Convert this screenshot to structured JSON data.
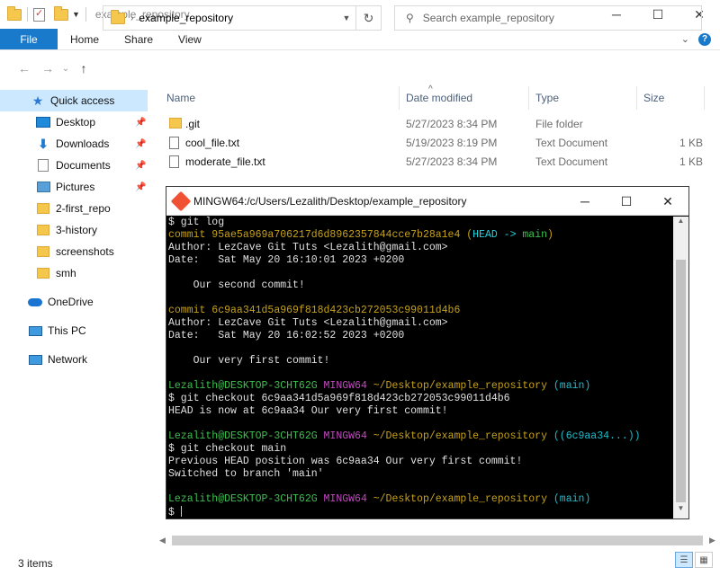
{
  "window": {
    "title": "example_repository",
    "min": "─",
    "max": "☐",
    "close": "✕"
  },
  "ribbon": {
    "file": "File",
    "tabs": [
      "Home",
      "Share",
      "View"
    ],
    "chevron": "⌄",
    "help": "?"
  },
  "nav": {
    "back": "←",
    "forward": "→",
    "recent": "⌄",
    "up": "↑",
    "breadcrumb_sep": "›",
    "path": "example_repository",
    "refresh": "↻",
    "search_placeholder": "Search example_repository"
  },
  "sidebar": {
    "items": [
      {
        "label": "Quick access",
        "icon": "star-icon"
      },
      {
        "label": "Desktop",
        "icon": "desktop-icon"
      },
      {
        "label": "Downloads",
        "icon": "download-icon"
      },
      {
        "label": "Documents",
        "icon": "documents-icon"
      },
      {
        "label": "Pictures",
        "icon": "pictures-icon"
      },
      {
        "label": "2-first_repo",
        "icon": "folder-icon"
      },
      {
        "label": "3-history",
        "icon": "folder-icon"
      },
      {
        "label": "screenshots",
        "icon": "folder-icon"
      },
      {
        "label": "smh",
        "icon": "folder-icon"
      },
      {
        "label": "OneDrive",
        "icon": "cloud-icon"
      },
      {
        "label": "This PC",
        "icon": "computer-icon"
      },
      {
        "label": "Network",
        "icon": "network-icon"
      }
    ]
  },
  "columns": {
    "name": "Name",
    "date": "Date modified",
    "type": "Type",
    "size": "Size"
  },
  "files": [
    {
      "name": ".git",
      "date": "5/27/2023 8:34 PM",
      "type": "File folder",
      "size": "",
      "icon": "folder-icon"
    },
    {
      "name": "cool_file.txt",
      "date": "5/19/2023 8:19 PM",
      "type": "Text Document",
      "size": "1 KB",
      "icon": "text-file-icon"
    },
    {
      "name": "moderate_file.txt",
      "date": "5/27/2023 8:34 PM",
      "type": "Text Document",
      "size": "1 KB",
      "icon": "text-file-icon"
    }
  ],
  "terminal": {
    "title": "MINGW64:/c/Users/Lezalith/Desktop/example_repository",
    "lines": [
      [
        {
          "t": "$ git log",
          "c": "c-w"
        }
      ],
      [
        {
          "t": "commit 95ae5a969a706217d6d8962357844cce7b28a1e4 ",
          "c": "c-y"
        },
        {
          "t": "(",
          "c": "c-y"
        },
        {
          "t": "HEAD -> ",
          "c": "c-hd"
        },
        {
          "t": "main",
          "c": "c-main"
        },
        {
          "t": ")",
          "c": "c-y"
        }
      ],
      [
        {
          "t": "Author: LezCave Git Tuts <Lezalith@gmail.com>",
          "c": "c-w"
        }
      ],
      [
        {
          "t": "Date:   Sat May 20 16:10:01 2023 +0200",
          "c": "c-w"
        }
      ],
      [
        {
          "t": "",
          "c": "c-w"
        }
      ],
      [
        {
          "t": "    Our second commit!",
          "c": "c-w"
        }
      ],
      [
        {
          "t": "",
          "c": "c-w"
        }
      ],
      [
        {
          "t": "commit 6c9aa341d5a969f818d423cb272053c99011d4b6",
          "c": "c-y"
        }
      ],
      [
        {
          "t": "Author: LezCave Git Tuts <Lezalith@gmail.com>",
          "c": "c-w"
        }
      ],
      [
        {
          "t": "Date:   Sat May 20 16:02:52 2023 +0200",
          "c": "c-w"
        }
      ],
      [
        {
          "t": "",
          "c": "c-w"
        }
      ],
      [
        {
          "t": "    Our very first commit!",
          "c": "c-w"
        }
      ],
      [
        {
          "t": "",
          "c": "c-w"
        }
      ],
      [
        {
          "t": "Lezalith@DESKTOP-3CHT62G ",
          "c": "c-g"
        },
        {
          "t": "MINGW64 ",
          "c": "c-m"
        },
        {
          "t": "~/Desktop/example_repository ",
          "c": "c-y"
        },
        {
          "t": "(main)",
          "c": "c-cy"
        }
      ],
      [
        {
          "t": "$ git checkout 6c9aa341d5a969f818d423cb272053c99011d4b6",
          "c": "c-w"
        }
      ],
      [
        {
          "t": "HEAD is now at 6c9aa34 Our very first commit!",
          "c": "c-w"
        }
      ],
      [
        {
          "t": "",
          "c": "c-w"
        }
      ],
      [
        {
          "t": "Lezalith@DESKTOP-3CHT62G ",
          "c": "c-g"
        },
        {
          "t": "MINGW64 ",
          "c": "c-m"
        },
        {
          "t": "~/Desktop/example_repository ",
          "c": "c-y"
        },
        {
          "t": "((6c9aa34...))",
          "c": "c-cy"
        }
      ],
      [
        {
          "t": "$ git checkout main",
          "c": "c-w"
        }
      ],
      [
        {
          "t": "Previous HEAD position was 6c9aa34 Our very first commit!",
          "c": "c-w"
        }
      ],
      [
        {
          "t": "Switched to branch 'main'",
          "c": "c-w"
        }
      ],
      [
        {
          "t": "",
          "c": "c-w"
        }
      ],
      [
        {
          "t": "Lezalith@DESKTOP-3CHT62G ",
          "c": "c-g"
        },
        {
          "t": "MINGW64 ",
          "c": "c-m"
        },
        {
          "t": "~/Desktop/example_repository ",
          "c": "c-y"
        },
        {
          "t": "(main)",
          "c": "c-cy"
        }
      ],
      [
        {
          "t": "$ ",
          "c": "c-w"
        }
      ]
    ]
  },
  "status": {
    "items": "3 items"
  }
}
